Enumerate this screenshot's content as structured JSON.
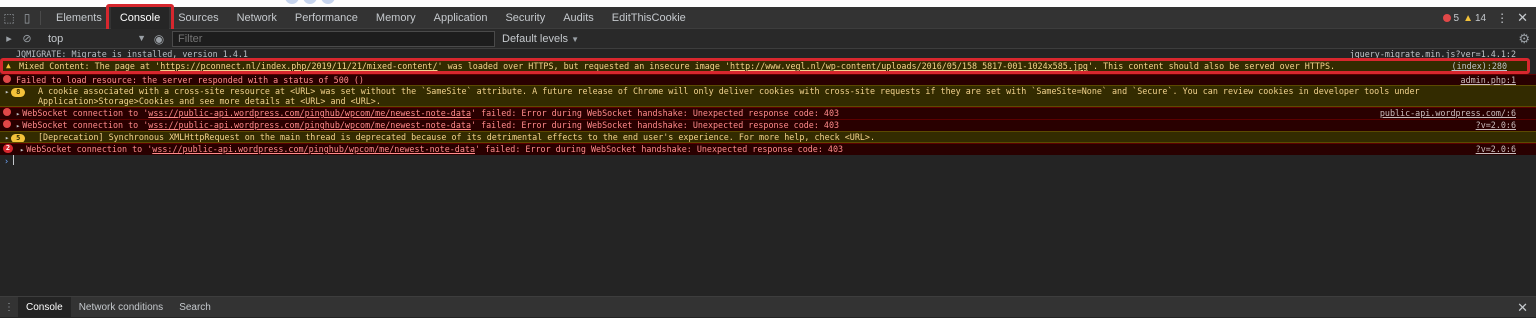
{
  "tabs": [
    {
      "label": "Elements"
    },
    {
      "label": "Console"
    },
    {
      "label": "Sources"
    },
    {
      "label": "Network"
    },
    {
      "label": "Performance"
    },
    {
      "label": "Memory"
    },
    {
      "label": "Application"
    },
    {
      "label": "Security"
    },
    {
      "label": "Audits"
    },
    {
      "label": "EditThisCookie"
    }
  ],
  "counts": {
    "errors": "5",
    "warnings": "14"
  },
  "toolbar": {
    "context": "top",
    "filter_placeholder": "Filter",
    "levels": "Default levels"
  },
  "messages": [
    {
      "type": "info",
      "text": "JQMIGRATE: Migrate is installed, version 1.4.1",
      "source": "jquery-migrate.min.js?ver=1.4.1:2"
    },
    {
      "type": "warning",
      "prefix": "Mixed Content: The page at '",
      "page_url": "https://pconnect.nl/index.php/2019/11/21/mixed-content/",
      "middle": "' was loaded over HTTPS, but requested an insecure image '",
      "image_url": "http://www.vegl.nl/wp-content/uploads/2016/05/158_5817-001-1024x585.jpg",
      "suffix": "'. This content should also be served over HTTPS.",
      "source": "(index):280"
    },
    {
      "type": "error",
      "text": "Failed to load resource: the server responded with a status of 500 ()",
      "source": "admin.php:1"
    },
    {
      "type": "warning",
      "count": "8",
      "line1": "A cookie associated with a cross-site resource at <URL> was set without the `SameSite` attribute. A future release of Chrome will only deliver cookies with cross-site requests if they are set with `SameSite=None` and `Secure`. You can review cookies in developer tools under",
      "line2": "Application>Storage>Cookies and see more details at <URL> and <URL>."
    },
    {
      "type": "error",
      "prefix": "WebSocket connection to '",
      "url": "wss://public-api.wordpress.com/pinghub/wpcom/me/newest-note-data",
      "suffix": "' failed: Error during WebSocket handshake: Unexpected response code: 403",
      "source": "public-api.wordpress.com/:6"
    },
    {
      "type": "error",
      "prefix": "WebSocket connection to '",
      "url": "wss://public-api.wordpress.com/pinghub/wpcom/me/newest-note-data",
      "suffix": "' failed: Error during WebSocket handshake: Unexpected response code: 403",
      "source": "?v=2.0:6"
    },
    {
      "type": "warning",
      "count": "5",
      "text": "[Deprecation] Synchronous XMLHttpRequest on the main thread is deprecated because of its detrimental effects to the end user's experience. For more help, check <URL>."
    },
    {
      "type": "error",
      "count": "2",
      "prefix": "WebSocket connection to '",
      "url": "wss://public-api.wordpress.com/pinghub/wpcom/me/newest-note-data",
      "suffix": "' failed: Error during WebSocket handshake: Unexpected response code: 403",
      "source": "?v=2.0:6"
    }
  ],
  "drawer": {
    "tabs": [
      {
        "label": "Console"
      },
      {
        "label": "Network conditions"
      },
      {
        "label": "Search"
      }
    ]
  },
  "colors": {
    "highlight": "#d7272e",
    "warning_bg": "#332b00",
    "error_bg": "#290000",
    "panel_bg": "#242424"
  }
}
